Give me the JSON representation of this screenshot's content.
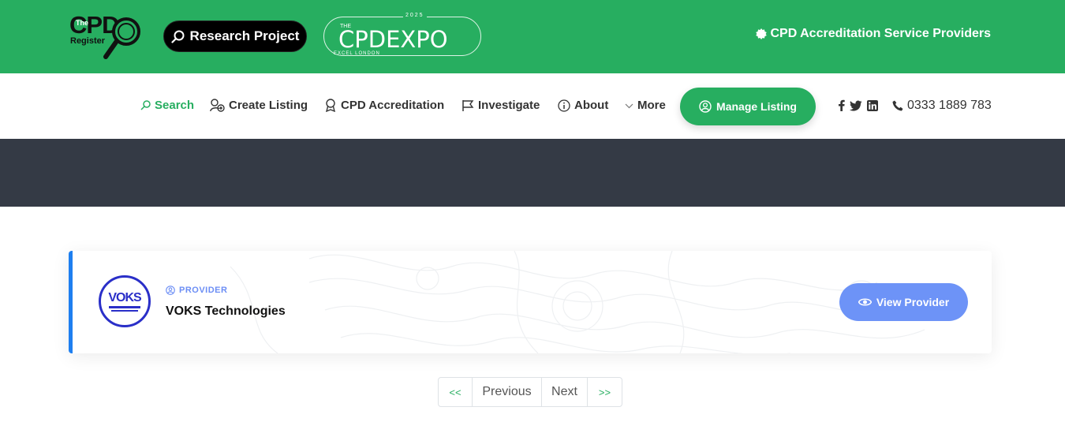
{
  "header": {
    "logo": {
      "the": "The",
      "cpd": "CPD",
      "register": "Register"
    },
    "research_button": "Research Project",
    "expo": {
      "year": "2025",
      "the": "THE",
      "name": "CPDEXPO",
      "venue": "EXCEL LONDON"
    },
    "accreditation_link": "CPD Accreditation Service Providers"
  },
  "nav": {
    "items": [
      {
        "label": "Search",
        "icon": "search-icon",
        "active": true
      },
      {
        "label": "Create Listing",
        "icon": "user-plus-icon"
      },
      {
        "label": "CPD Accreditation",
        "icon": "award-icon"
      },
      {
        "label": "Investigate",
        "icon": "flag-icon"
      },
      {
        "label": "About",
        "icon": "info-icon"
      },
      {
        "label": "More",
        "icon": "chevron-down-icon"
      }
    ],
    "manage_button": "Manage Listing",
    "phone": "0333 1889 783"
  },
  "listing": {
    "avatar_text": "VOKS",
    "tag": "PROVIDER",
    "name": "VOKS Technologies",
    "view_button": "View Provider"
  },
  "pagination": {
    "first": "<<",
    "previous": "Previous",
    "next": "Next",
    "last": ">>"
  },
  "colors": {
    "brand_green": "#27ae60",
    "banner": "#343a45",
    "accent_blue": "#1e7ff0",
    "button_blue": "#6d93f7"
  }
}
